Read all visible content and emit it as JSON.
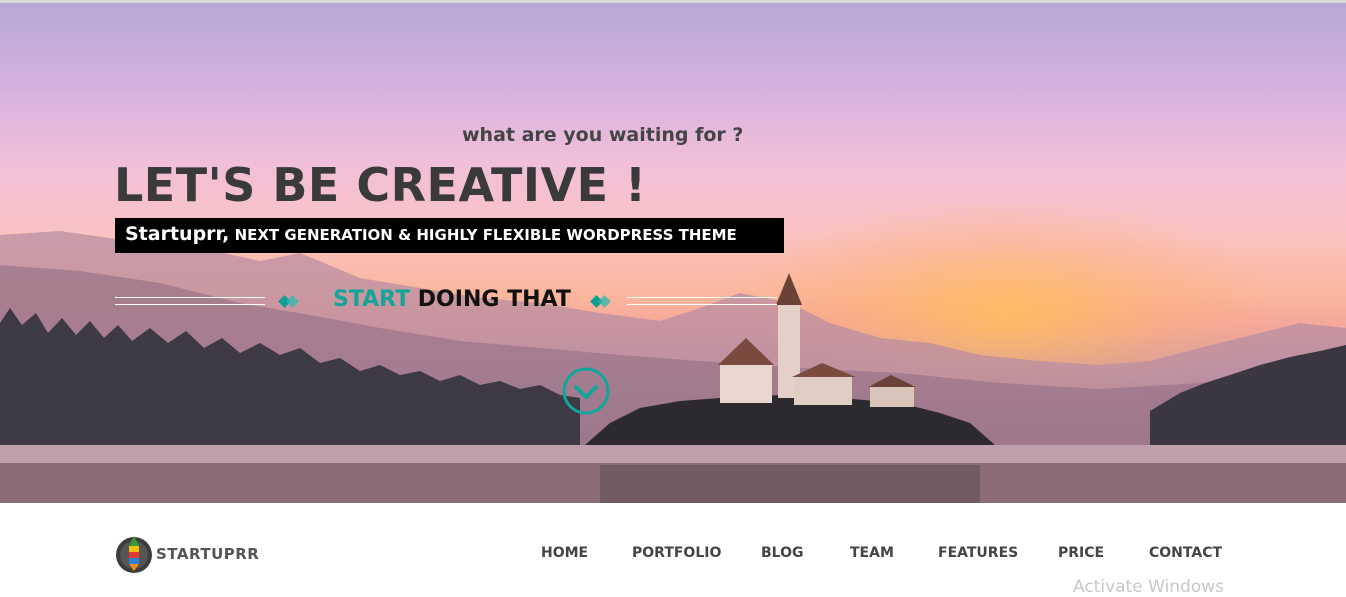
{
  "hero": {
    "tagline": "what are you waiting for ?",
    "headline": "LET'S BE CREATIVE !",
    "subtitle_brand": "Startuprr,",
    "subtitle_rest": " NEXT GENERATION & HIGHLY FLEXIBLE WORDPRESS THEME",
    "cta_highlight": "START",
    "cta_rest": " DOING THAT"
  },
  "brand": {
    "logo_text": "STARTUPRR"
  },
  "nav": {
    "items": [
      "HOME",
      "PORTFOLIO",
      "BLOG",
      "TEAM",
      "FEATURES",
      "PRICE",
      "CONTACT"
    ]
  },
  "watermark": "Activate Windows",
  "colors": {
    "accent": "#13a49a",
    "dark_text": "#3a3a3a",
    "nav_text": "#444444"
  },
  "icons": [
    "chevron-down-circle-icon",
    "rocket-logo-icon",
    "double-arrow-icon"
  ]
}
